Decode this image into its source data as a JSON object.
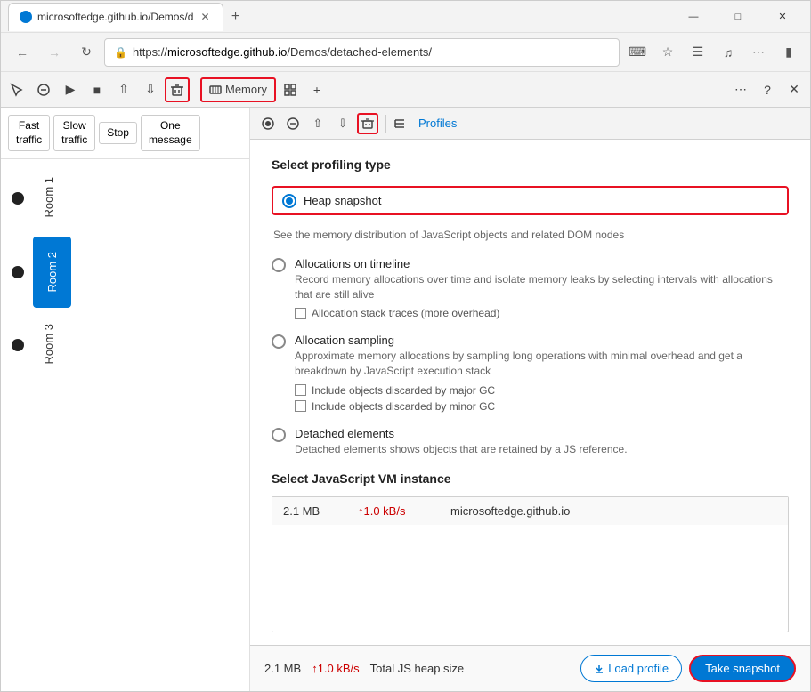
{
  "browser": {
    "tab_title": "microsoftedge.github.io/Demos/d",
    "url": "https://microsoftedge.github.io/Demos/detached-elements/",
    "url_domain": "microsoftedge.github.io",
    "url_path": "/Demos/detached-elements/",
    "new_tab_label": "+",
    "minimize_label": "—",
    "maximize_label": "□",
    "close_label": "✕"
  },
  "devtools": {
    "memory_tab_label": "Memory",
    "toolbar_icons": [
      "inspect",
      "console",
      "sources",
      "network",
      "performance",
      "memory",
      "application",
      "security"
    ],
    "right_icons": [
      "more",
      "help",
      "close"
    ]
  },
  "page_controls": {
    "fast_traffic_label": "Fast\ntraffic",
    "slow_traffic_label": "Slow\ntraffic",
    "stop_label": "Stop",
    "one_message_label": "One\nmessage"
  },
  "rooms": [
    {
      "name": "Room 1",
      "active": false
    },
    {
      "name": "Room 2",
      "active": true
    },
    {
      "name": "Room 3",
      "active": false
    }
  ],
  "profiler": {
    "profiles_label": "Profiles",
    "section_title": "Select profiling type",
    "options": [
      {
        "id": "heap-snapshot",
        "label": "Heap snapshot",
        "description": "See the memory distribution of JavaScript objects and related DOM nodes",
        "selected": true,
        "checkboxes": []
      },
      {
        "id": "allocations-timeline",
        "label": "Allocations on timeline",
        "description": "Record memory allocations over time and isolate memory leaks by selecting intervals with allocations that are still alive",
        "selected": false,
        "checkboxes": [
          {
            "label": "Allocation stack traces (more overhead)",
            "checked": false
          }
        ]
      },
      {
        "id": "allocation-sampling",
        "label": "Allocation sampling",
        "description": "Approximate memory allocations by sampling long operations with minimal overhead and get a breakdown by JavaScript execution stack",
        "selected": false,
        "checkboxes": [
          {
            "label": "Include objects discarded by major GC",
            "checked": false
          },
          {
            "label": "Include objects discarded by minor GC",
            "checked": false
          }
        ]
      },
      {
        "id": "detached-elements",
        "label": "Detached elements",
        "description": "Detached elements shows objects that are retained by a JS reference.",
        "selected": false,
        "checkboxes": []
      }
    ],
    "vm_section_title": "Select JavaScript VM instance",
    "vm_instances": [
      {
        "size": "2.1 MB",
        "rate": "↑1.0 kB/s",
        "url": "microsoftedge.github.io"
      }
    ],
    "footer": {
      "size": "2.1 MB",
      "rate": "↑1.0 kB/s",
      "heap_label": "Total JS heap size",
      "load_profile_label": "Load profile",
      "take_snapshot_label": "Take snapshot"
    }
  }
}
